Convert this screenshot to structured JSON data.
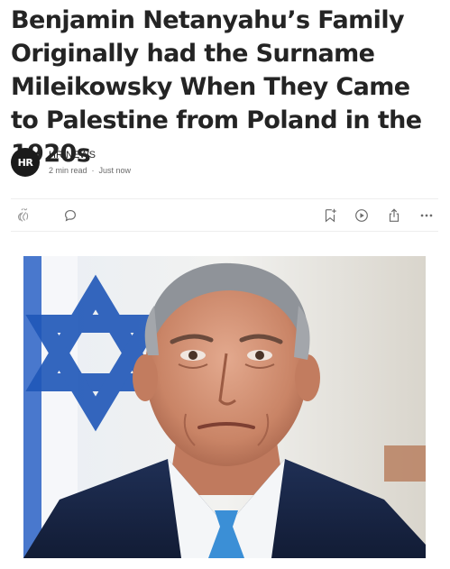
{
  "article": {
    "title": "Benjamin Netanyahu’s Family Originally had the Surname Mileikowsky When They Came to Palestine from Poland in the 1920s"
  },
  "author": {
    "avatar_text": "HR",
    "name": "HR NEWS",
    "read_time": "2 min read",
    "separator": "·",
    "published": "Just now"
  },
  "actions": {
    "left": [
      "clap-icon",
      "comment-icon"
    ],
    "right": [
      "bookmark-add-icon",
      "play-icon",
      "share-icon",
      "more-icon"
    ]
  },
  "colors": {
    "text": "#242424",
    "muted": "#6b6b6b",
    "flag_blue": "#1f57b8"
  }
}
